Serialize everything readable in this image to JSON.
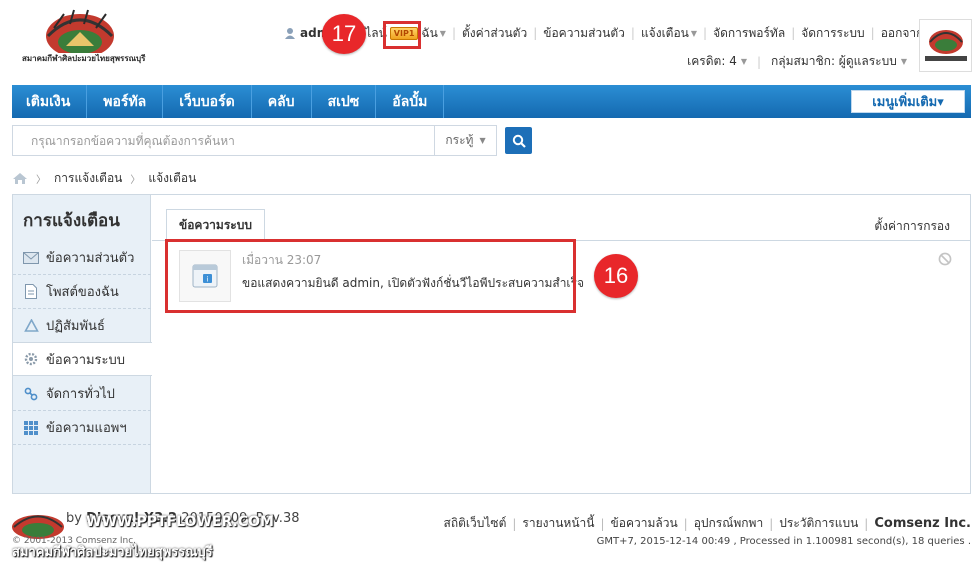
{
  "header": {
    "site_logo_text": "สมาคมกีฬาศิลปะมวยไทยสุพรรณบุรี",
    "user_name": "adm",
    "online_text": "ไลน์",
    "vip_label": "VIP1",
    "my_label": "ฉัน",
    "links": [
      "ตั้งค่าส่วนตัว",
      "ข้อความส่วนตัว",
      "แจ้งเตือน",
      "จัดการพอร์ทัล",
      "จัดการระบบ",
      "ออกจากระบบ"
    ],
    "credit_label": "เครดิต: 4",
    "group_label": "กลุ่มสมาชิก: ผู้ดูแลระบบ"
  },
  "nav": {
    "items": [
      "เติมเงิน",
      "พอร์ทัล",
      "เว็บบอร์ด",
      "คลับ",
      "สเปซ",
      "อัลบั้ม"
    ],
    "more_label": "เมนูเพิ่มเติม▾"
  },
  "search": {
    "placeholder": "กรุณากรอกข้อความที่คุณต้องการค้นหา",
    "scope": "กระทู้"
  },
  "breadcrumb": [
    "การแจ้งเตือน",
    "แจ้งเตือน"
  ],
  "sidebar": {
    "title": "การแจ้งเตือน",
    "items": [
      {
        "label": "ข้อความส่วนตัว",
        "icon": "envelope-icon"
      },
      {
        "label": "โพสต์ของฉัน",
        "icon": "document-icon"
      },
      {
        "label": "ปฏิสัมพันธ์",
        "icon": "recycle-icon"
      },
      {
        "label": "ข้อความระบบ",
        "icon": "gear-icon"
      },
      {
        "label": "จัดการทั่วไป",
        "icon": "link-icon"
      },
      {
        "label": "ข้อความแอพฯ",
        "icon": "grid-icon"
      }
    ]
  },
  "main": {
    "tab_label": "ข้อความระบบ",
    "filter_label": "ตั้งค่าการกรอง",
    "notice": {
      "time": "เมื่อวาน 23:07",
      "text": "ขอแสดงความยินดี admin, เปิดตัวฟังก์ชั่นวีไอพีประสบความสำเร็จ"
    }
  },
  "annotations": {
    "marker_17": "17",
    "marker_16": "16"
  },
  "footer": {
    "brand_prefix": "by ",
    "brand": "Discuz! X3.2",
    "version": " 20150609, Rev.38",
    "copyright": "© 2001-2013 Comsenz Inc.",
    "watermark_url": "WWW.PPTFLOWER.COM",
    "watermark_text": "สมาคมกีฬาศิลปะมวยไทยสุพรรณบุรี",
    "links": [
      "สถิติเว็บไซต์",
      "รายงานหน้านี้",
      "ข้อความล้วน",
      "อุปกรณ์พกพา",
      "ประวัติการแบน"
    ],
    "company": "Comsenz Inc.",
    "stats": "GMT+7, 2015-12-14 00:49 , Processed in 1.100981 second(s), 18 queries ."
  }
}
